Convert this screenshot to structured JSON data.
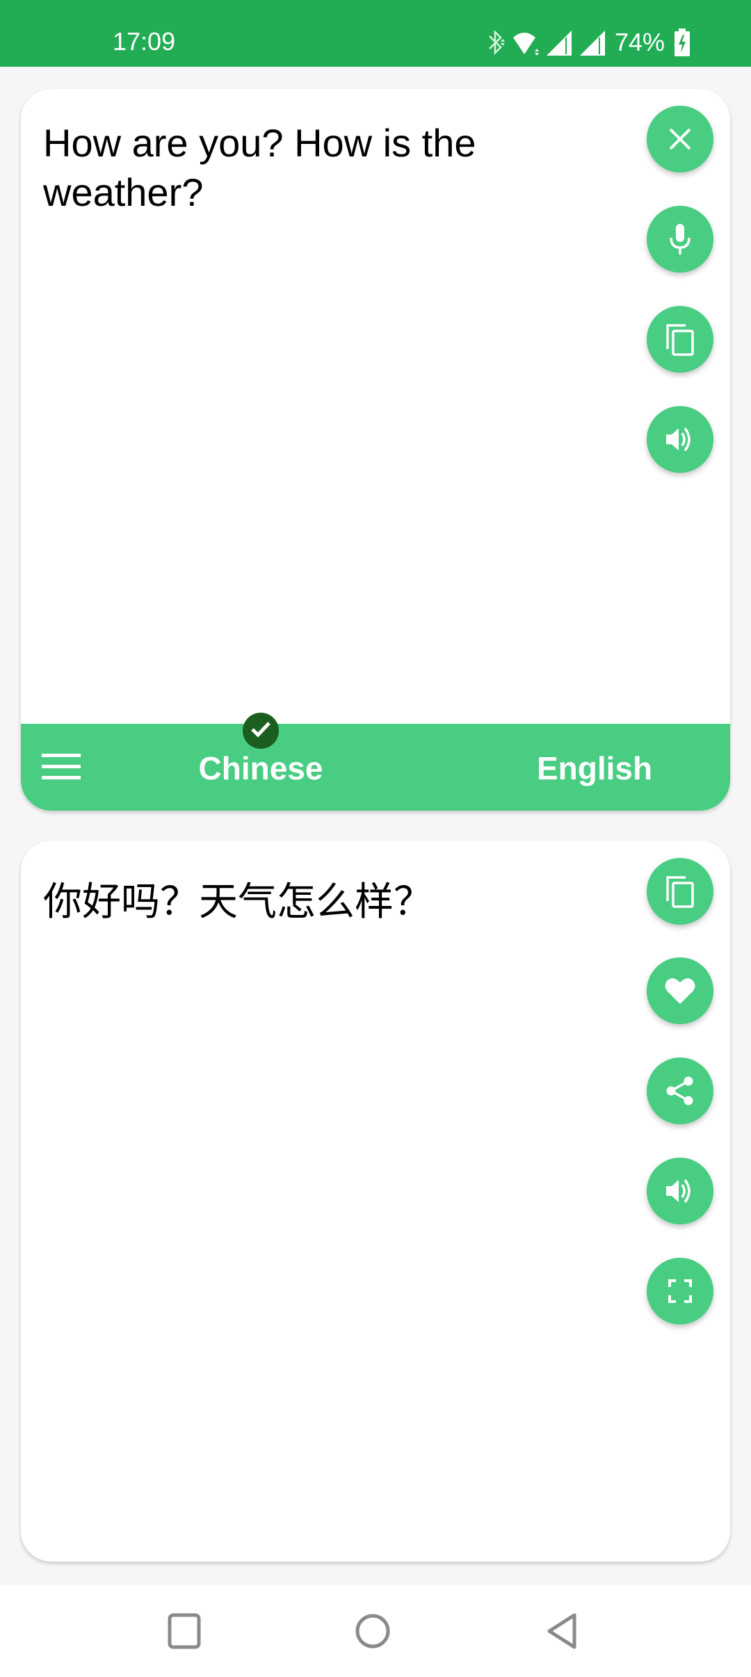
{
  "status_bar": {
    "time": "17:09",
    "battery_percent": "74%",
    "icons": [
      "bluetooth-icon",
      "wifi-icon",
      "signal-icon",
      "signal-icon",
      "battery-charging-icon"
    ]
  },
  "source_panel": {
    "text": "How are you? How is the weather?",
    "actions": [
      {
        "icon": "close-icon",
        "label": "Clear"
      },
      {
        "icon": "microphone-icon",
        "label": "Voice input"
      },
      {
        "icon": "copy-icon",
        "label": "Copy"
      },
      {
        "icon": "speaker-icon",
        "label": "Speak"
      }
    ]
  },
  "language_bar": {
    "menu_icon": "menu-icon",
    "source_language": "Chinese",
    "target_language": "English",
    "selected_indicator": "check-icon"
  },
  "result_panel": {
    "text": "你好吗？天气怎么样？",
    "actions": [
      {
        "icon": "copy-icon",
        "label": "Copy"
      },
      {
        "icon": "heart-icon",
        "label": "Favorite"
      },
      {
        "icon": "share-icon",
        "label": "Share"
      },
      {
        "icon": "speaker-icon",
        "label": "Speak"
      },
      {
        "icon": "fullscreen-icon",
        "label": "Fullscreen"
      }
    ]
  },
  "nav_bar": {
    "buttons": [
      "recents",
      "home",
      "back"
    ]
  },
  "colors": {
    "status_bar": "#22AD55",
    "accent": "#48CD82",
    "check_badge": "#1B5E20",
    "background": "#F6F6F6"
  }
}
